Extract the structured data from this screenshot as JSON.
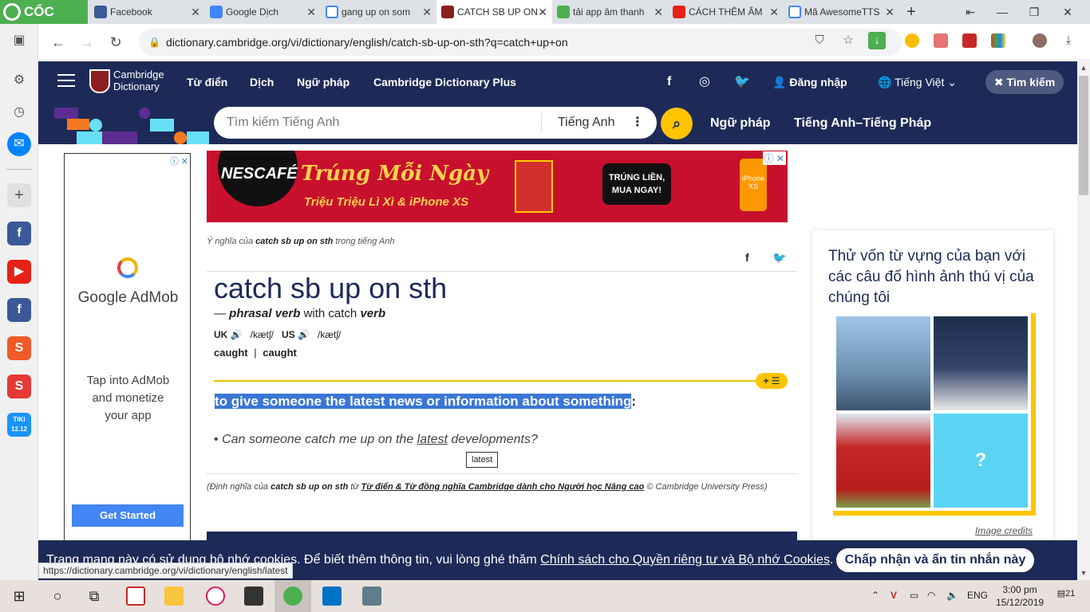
{
  "browser": {
    "brand": "CỐC CỐC",
    "tabs": [
      {
        "title": "Facebook"
      },
      {
        "title": "Google Dịch"
      },
      {
        "title": "gang up on som"
      },
      {
        "title": "CATCH SB UP ON"
      },
      {
        "title": "tải app âm thanh"
      },
      {
        "title": "CÁCH THÊM ÂM"
      },
      {
        "title": "Mã AwesomeTTS"
      }
    ],
    "url": "dictionary.cambridge.org/vi/dictionary/english/catch-sb-up-on-sth?q=catch+up+on",
    "status_url": "https://dictionary.cambridge.org/vi/dictionary/english/latest"
  },
  "header": {
    "logo_line1": "Cambridge",
    "logo_line2": "Dictionary",
    "nav": [
      "Từ điển",
      "Dịch",
      "Ngữ pháp",
      "Cambridge Dictionary Plus"
    ],
    "login": "Đăng nhập",
    "language": "Tiếng Việt",
    "search_pill": "Tìm kiếm"
  },
  "search": {
    "placeholder": "Tìm kiếm Tiếng Anh",
    "language": "Tiếng Anh",
    "link1": "Ngữ pháp",
    "link2": "Tiếng Anh–Tiếng Pháp"
  },
  "ad_left": {
    "brand": "Google AdMob",
    "tagline": [
      "Tap into AdMob",
      "and monetize",
      "your app"
    ],
    "cta": "Get Started"
  },
  "banner": {
    "brand": "NESCAFÉ",
    "headline": "Trúng Mỗi Ngày",
    "sub": "Triệu Triệu Lì Xì & iPhone XS",
    "cta_line1": "TRÚNG LIỀN,",
    "cta_line2": "MUA NGAY!",
    "phone_label": "iPhone XS"
  },
  "entry": {
    "breadcrumb_pre": "Ý nghĩa của",
    "breadcrumb_word": "catch sb up on sth",
    "breadcrumb_post": "trong tiếng Anh",
    "headword": "catch sb up on sth",
    "pos_dash": "—",
    "pos": "phrasal verb",
    "pos_with": "with catch",
    "pos_base": "verb",
    "uk_label": "UK",
    "uk_ipa": "/kætʃ/",
    "us_label": "US",
    "us_ipa": "/kætʃ/",
    "form1": "caught",
    "form_sep": "|",
    "form2": "caught",
    "plus_label": "+",
    "definition": "to give someone the latest news or information about something",
    "definition_end": ":",
    "example_pre": "Can someone catch me up on the",
    "example_link": "latest",
    "example_post": "developments?",
    "tooltip": "latest",
    "source_pre": "(Định nghĩa của",
    "source_word": "catch sb up on sth",
    "source_from": "từ",
    "source_link": "Từ điển & Từ đồng nghĩa Cambridge dành cho Người học Nâng cao",
    "source_post": "© Cambridge University Press)"
  },
  "quiz": {
    "title": "Thử vốn từ vựng của bạn với các câu đố hình ảnh thú vị của chúng tôi",
    "credits": "Image credits",
    "mystery": "?"
  },
  "cookie": {
    "text": "Trang mạng này có sử dụng bộ nhớ cookies. Để biết thêm thông tin, vui lòng ghé thăm",
    "link": "Chính sách cho Quyền riêng tư và Bộ nhớ Cookies",
    "end": ".",
    "button": "Chấp nhận và ẩn tin nhắn này"
  },
  "taskbar": {
    "lang": "ENG",
    "time": "3:00 pm",
    "date": "15/12/2019",
    "notifications": "21",
    "tiki_line1": "TIKI",
    "tiki_line2": "12.12"
  },
  "colors": {
    "cambridge_navy": "#1d2a57",
    "accent_yellow": "#fec400",
    "selection_blue": "#3a76d6",
    "coccoc_green": "#4caf50"
  }
}
